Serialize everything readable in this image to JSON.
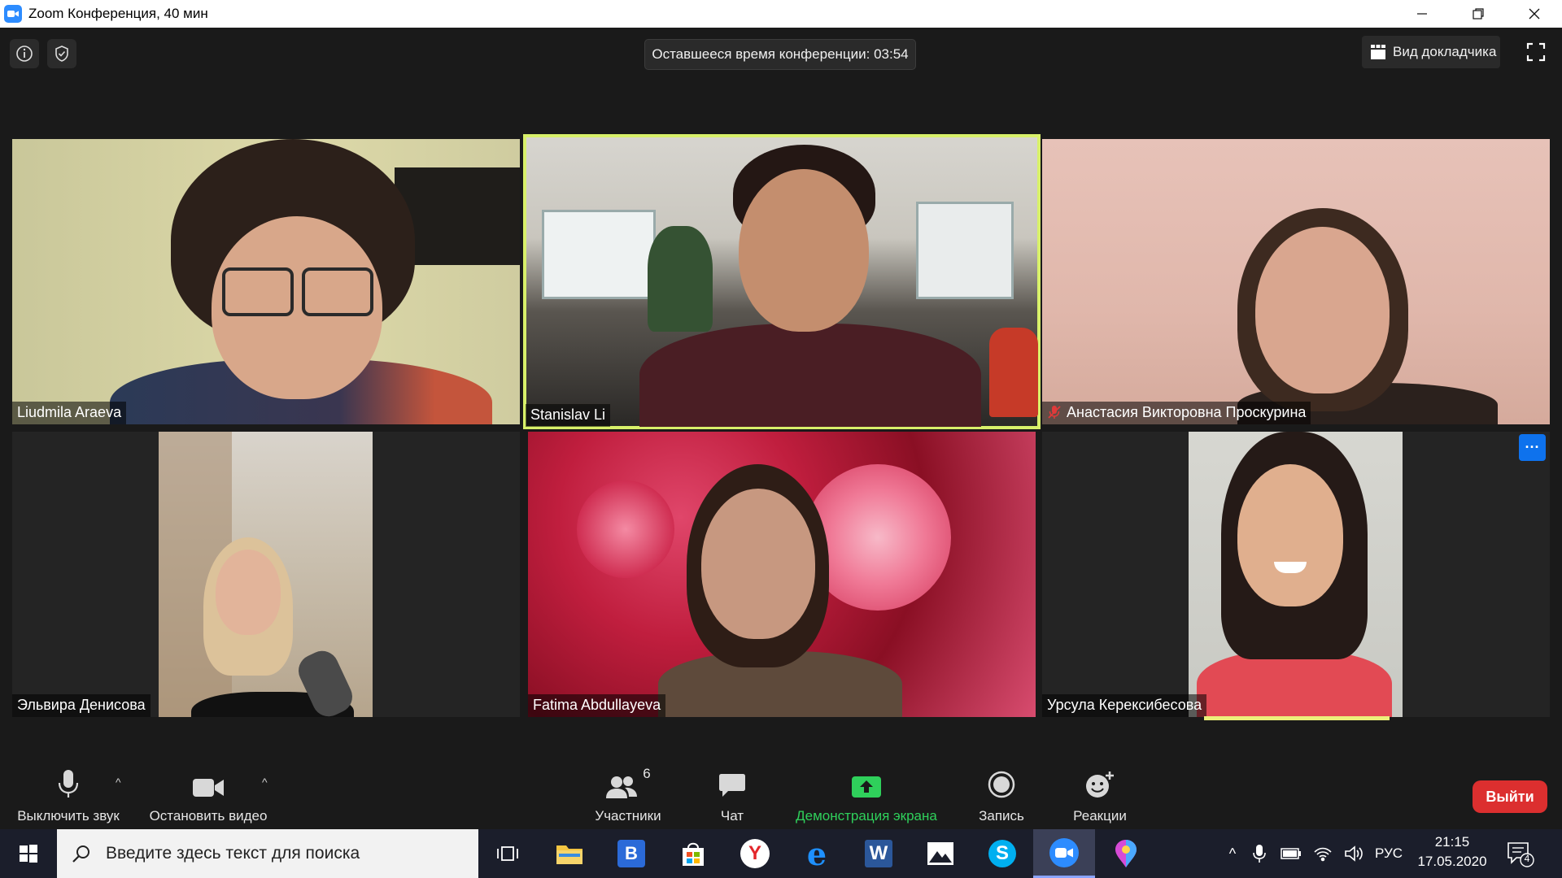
{
  "window": {
    "title": "Zoom Конференция, 40 мин"
  },
  "meeting": {
    "remaining_time": "Оставшееся время конференции: 03:54",
    "speaker_view_label": "Вид докладчика"
  },
  "participants": [
    {
      "name": "Liudmila Araeva",
      "muted": false,
      "active": false
    },
    {
      "name": "Stanislav Li",
      "muted": false,
      "active": true
    },
    {
      "name": "Анастасия Викторовна Проскурина",
      "muted": true,
      "active": false
    },
    {
      "name": "Эльвира Денисова",
      "muted": false,
      "active": false
    },
    {
      "name": "Fatima Abdullayeva",
      "muted": false,
      "active": false
    },
    {
      "name": "Урсула Керексибесова",
      "muted": false,
      "active": false
    }
  ],
  "toolbar": {
    "mute_label": "Выключить звук",
    "video_label": "Остановить видео",
    "participants_label": "Участники",
    "participants_count": "6",
    "chat_label": "Чат",
    "share_label": "Демонстрация экрана",
    "record_label": "Запись",
    "reactions_label": "Реакции",
    "leave_label": "Выйти",
    "more_label": "···"
  },
  "taskbar": {
    "search_placeholder": "Введите здесь текст для поиска",
    "language": "РУС",
    "time": "21:15",
    "date": "17.05.2020",
    "notification_count": "4",
    "apps": [
      "task-view",
      "file-explorer",
      "vk-browser",
      "microsoft-store",
      "yandex-browser",
      "edge",
      "word",
      "photos",
      "skype",
      "zoom",
      "maps-pin"
    ]
  },
  "colors": {
    "active_speaker": "#d8f06a",
    "share_green": "#2fd05b",
    "leave_red": "#dc2f2f",
    "accent_blue": "#0e72ed"
  }
}
